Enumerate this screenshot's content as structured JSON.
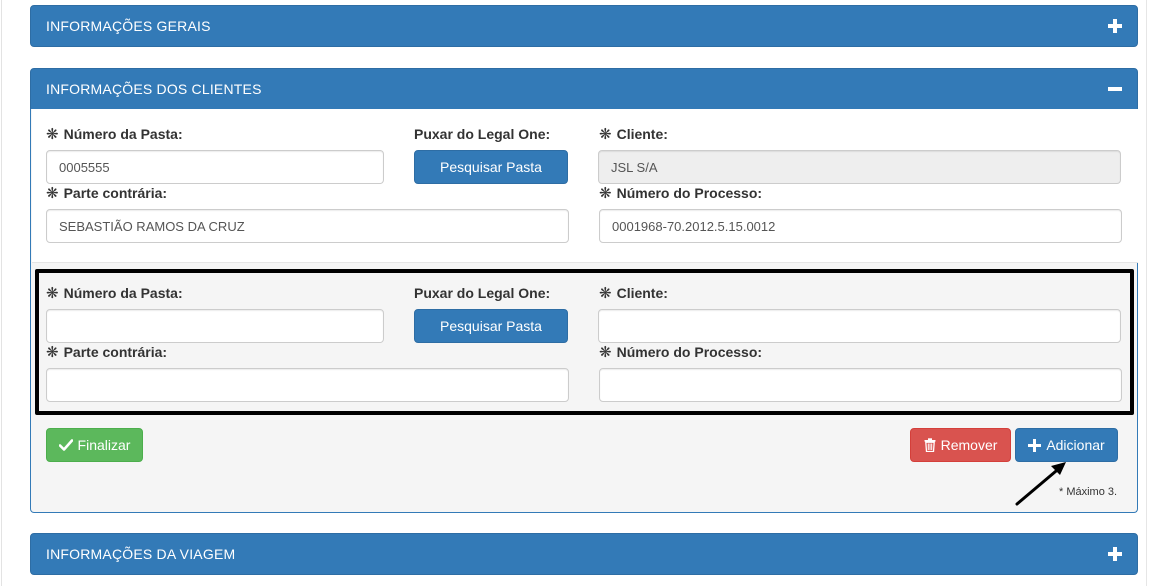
{
  "sections": {
    "general": {
      "title": "INFORMAÇÕES GERAIS",
      "toggle_icon": "plus-icon"
    },
    "clients": {
      "title": "INFORMAÇÕES DOS CLIENTES",
      "toggle_icon": "minus-icon"
    },
    "travel": {
      "title": "INFORMAÇÕES DA VIAGEM",
      "toggle_icon": "plus-icon"
    }
  },
  "client1": {
    "folder_label": "Número da Pasta:",
    "folder_value": "0005555",
    "pull_label": "Puxar do Legal One:",
    "search_button": "Pesquisar Pasta",
    "client_label": "Cliente:",
    "client_value": "JSL S/A",
    "opposing_label": "Parte contrária:",
    "opposing_value": "SEBASTIÃO RAMOS DA CRUZ",
    "process_label": "Número do Processo:",
    "process_value": "0001968-70.2012.5.15.0012"
  },
  "client2": {
    "folder_label": "Número da Pasta:",
    "folder_value": "",
    "pull_label": "Puxar do Legal One:",
    "search_button": "Pesquisar Pasta",
    "client_label": "Cliente:",
    "client_value": "",
    "opposing_label": "Parte contrária:",
    "opposing_value": "",
    "process_label": "Número do Processo:",
    "process_value": ""
  },
  "required_marker": "❋",
  "actions": {
    "finish": "Finalizar",
    "remove": "Remover",
    "add": "Adicionar",
    "max_note": "* Máximo 3."
  },
  "colors": {
    "primary": "#337ab7",
    "success": "#5cb85c",
    "danger": "#d9534f"
  }
}
